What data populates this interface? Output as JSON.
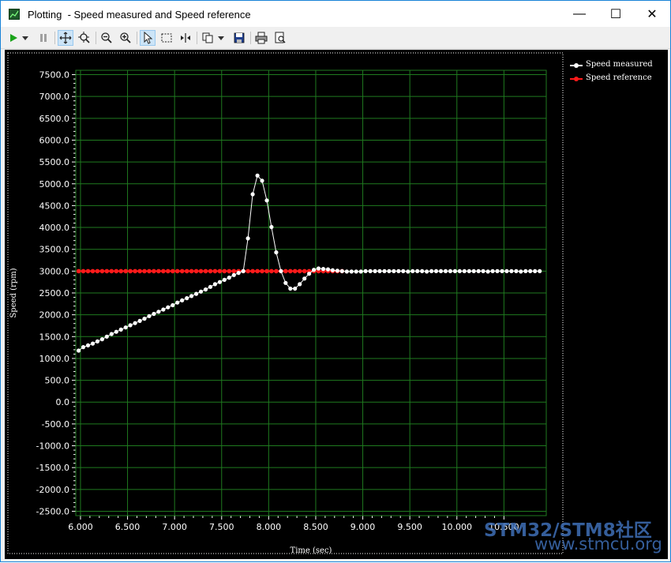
{
  "window": {
    "title": "Plotting  - Speed measured and Speed reference",
    "minimize_glyph": "—",
    "maximize_glyph": "☐",
    "close_glyph": "✕"
  },
  "toolbar": {
    "items": [
      "play-icon",
      "dropdown-arrow-icon",
      "pause-icon",
      "pan-icon",
      "zoom-fit-icon",
      "zoom-out-icon",
      "zoom-in-icon",
      "select-pointer-icon",
      "select-rect-icon",
      "cursor-measure-icon",
      "copy-icon",
      "dropdown-arrow-icon",
      "save-icon",
      "print-icon",
      "print-preview-icon"
    ]
  },
  "colors": {
    "background": "#000000",
    "grid": "#1f7a1f",
    "measured": "#ffffff",
    "reference": "#ff1a1a",
    "axis_text": "#ffffff"
  },
  "chart_data": {
    "type": "line",
    "title": "",
    "xlabel": "Time (sec)",
    "ylabel": "Speed (rpm)",
    "xlim": [
      5.95,
      10.95
    ],
    "ylim": [
      -2600,
      7600
    ],
    "xticks": [
      6.0,
      6.5,
      7.0,
      7.5,
      8.0,
      8.5,
      9.0,
      9.5,
      10.0,
      10.5
    ],
    "xtick_labels": [
      "6.000",
      "6.500",
      "7.000",
      "7.500",
      "8.000",
      "8.500",
      "9.000",
      "9.500",
      "10.000",
      "10.500"
    ],
    "yticks": [
      7500,
      7000,
      6500,
      6000,
      5500,
      5000,
      4500,
      4000,
      3500,
      3000,
      2500,
      2000,
      1500,
      1000,
      500,
      0,
      -500,
      -1000,
      -1500,
      -2000,
      -2500
    ],
    "ytick_labels": [
      "7500.0",
      "7000.0",
      "6500.0",
      "6000.0",
      "5500.0",
      "5000.0",
      "4500.0",
      "4000.0",
      "3500.0",
      "3000.0",
      "2500.0",
      "2000.0",
      "1500.0",
      "1000.0",
      "500.0",
      "0.0",
      "-500.0",
      "-1000.0",
      "-1500.0",
      "-2000.0",
      "-2500.0"
    ],
    "grid": true,
    "legend_position": "right",
    "series": [
      {
        "name": "Speed measured",
        "color": "#ffffff",
        "x": [
          5.98,
          6.03,
          6.08,
          6.13,
          6.18,
          6.23,
          6.28,
          6.33,
          6.38,
          6.43,
          6.48,
          6.53,
          6.58,
          6.63,
          6.68,
          6.73,
          6.78,
          6.83,
          6.88,
          6.93,
          6.98,
          7.03,
          7.08,
          7.13,
          7.18,
          7.23,
          7.28,
          7.33,
          7.38,
          7.43,
          7.48,
          7.53,
          7.58,
          7.63,
          7.68,
          7.73,
          7.78,
          7.83,
          7.88,
          7.93,
          7.98,
          8.03,
          8.08,
          8.13,
          8.18,
          8.23,
          8.28,
          8.33,
          8.38,
          8.43,
          8.48,
          8.53,
          8.58,
          8.63,
          8.68,
          8.73,
          8.78,
          8.83,
          8.88,
          8.93,
          8.98,
          9.03,
          9.08,
          9.13,
          9.18,
          9.23,
          9.28,
          9.33,
          9.38,
          9.43,
          9.48,
          9.53,
          9.58,
          9.63,
          9.68,
          9.73,
          9.78,
          9.83,
          9.88,
          9.93,
          9.98,
          10.03,
          10.08,
          10.13,
          10.18,
          10.23,
          10.28,
          10.33,
          10.38,
          10.43,
          10.48,
          10.53,
          10.58,
          10.63,
          10.68,
          10.73,
          10.78,
          10.83,
          10.88
        ],
        "y": [
          1180,
          1260,
          1300,
          1340,
          1390,
          1440,
          1500,
          1560,
          1610,
          1660,
          1710,
          1760,
          1810,
          1860,
          1910,
          1970,
          2020,
          2070,
          2120,
          2170,
          2220,
          2280,
          2330,
          2380,
          2430,
          2480,
          2530,
          2580,
          2640,
          2700,
          2750,
          2800,
          2850,
          2910,
          2960,
          3000,
          3750,
          4760,
          5190,
          5070,
          4620,
          4010,
          3430,
          3000,
          2730,
          2600,
          2600,
          2700,
          2830,
          2940,
          3030,
          3060,
          3050,
          3040,
          3020,
          3010,
          3000,
          2990,
          2990,
          2990,
          2990,
          3000,
          3000,
          3000,
          3000,
          3000,
          3000,
          3000,
          3000,
          3000,
          2990,
          3000,
          3000,
          3000,
          2990,
          3000,
          3000,
          3000,
          3000,
          3000,
          3000,
          3000,
          3000,
          3000,
          3000,
          3000,
          3000,
          2990,
          3000,
          3000,
          3000,
          3000,
          3000,
          3000,
          2990,
          3000,
          3000,
          3000,
          3000
        ]
      },
      {
        "name": "Speed reference",
        "color": "#ff1a1a",
        "x": [
          5.98,
          6.03,
          6.08,
          6.13,
          6.18,
          6.23,
          6.28,
          6.33,
          6.38,
          6.43,
          6.48,
          6.53,
          6.58,
          6.63,
          6.68,
          6.73,
          6.78,
          6.83,
          6.88,
          6.93,
          6.98,
          7.03,
          7.08,
          7.13,
          7.18,
          7.23,
          7.28,
          7.33,
          7.38,
          7.43,
          7.48,
          7.53,
          7.58,
          7.63,
          7.68,
          7.73,
          7.78,
          7.83,
          7.88,
          7.93,
          7.98,
          8.03,
          8.08,
          8.13,
          8.18,
          8.23,
          8.28,
          8.33,
          8.38,
          8.43,
          8.48,
          8.53,
          8.58,
          8.63,
          8.68,
          8.73,
          8.78
        ],
        "y": [
          3000,
          3000,
          3000,
          3000,
          3000,
          3000,
          3000,
          3000,
          3000,
          3000,
          3000,
          3000,
          3000,
          3000,
          3000,
          3000,
          3000,
          3000,
          3000,
          3000,
          3000,
          3000,
          3000,
          3000,
          3000,
          3000,
          3000,
          3000,
          3000,
          3000,
          3000,
          3000,
          3000,
          3000,
          3000,
          3000,
          3000,
          3000,
          3000,
          3000,
          3000,
          3000,
          3000,
          3000,
          3000,
          3000,
          3000,
          3000,
          3000,
          3000,
          3000,
          3000,
          3000,
          3000,
          3000,
          3000,
          3000
        ]
      }
    ]
  },
  "watermark": {
    "line1": "STM32/STM8社区",
    "line2": "www.stmcu.org"
  }
}
